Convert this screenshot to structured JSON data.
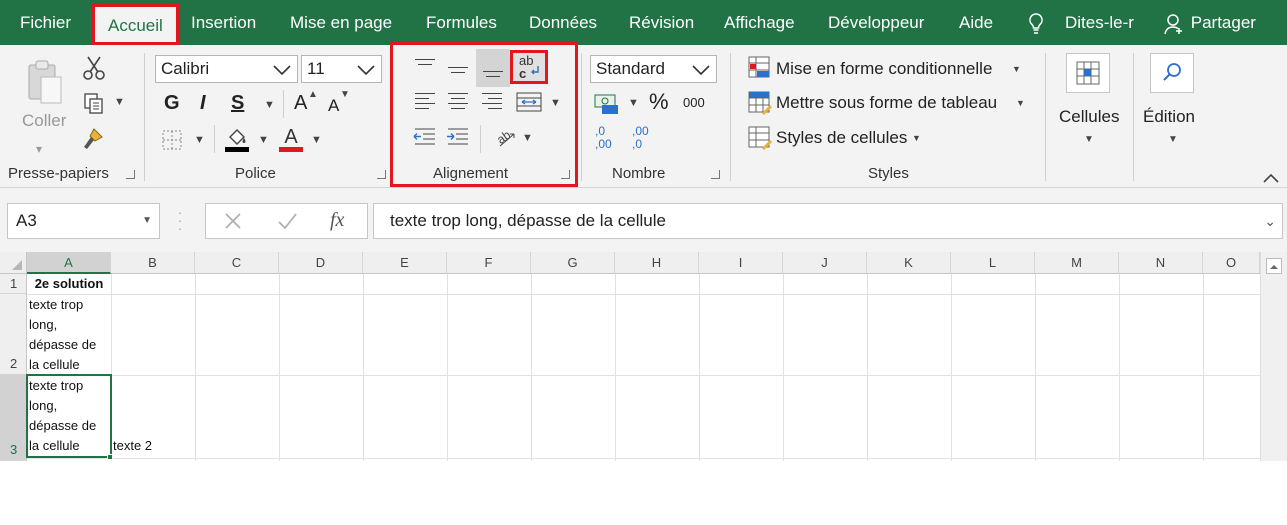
{
  "menu": {
    "tabs": [
      {
        "label": "Fichier"
      },
      {
        "label": "Accueil"
      },
      {
        "label": "Insertion"
      },
      {
        "label": "Mise en page"
      },
      {
        "label": "Formules"
      },
      {
        "label": "Données"
      },
      {
        "label": "Révision"
      },
      {
        "label": "Affichage"
      },
      {
        "label": "Développeur"
      },
      {
        "label": "Aide"
      }
    ],
    "active_tab": "Accueil",
    "tell_me": "Dites-le-r",
    "share": "Partager"
  },
  "ribbon": {
    "clipboard": {
      "paste": "Coller",
      "group": "Presse-papiers"
    },
    "font": {
      "name": "Calibri",
      "size": "11",
      "bold": "G",
      "italic": "I",
      "underline": "S",
      "grow": "A",
      "shrink": "A",
      "group": "Police",
      "fill_color": "#000000",
      "font_color": "#e2161e"
    },
    "alignment": {
      "group": "Alignement",
      "wrap_icon": "ab c"
    },
    "number": {
      "format": "Standard",
      "percent": "%",
      "thousands": "000",
      "inc_decimal": ",0 ,00",
      "dec_decimal": ",00 ,0",
      "group": "Nombre"
    },
    "styles": {
      "conditional": "Mise en forme conditionnelle",
      "table": "Mettre sous forme de tableau",
      "cell_styles": "Styles de cellules",
      "group": "Styles"
    },
    "cells": {
      "label": "Cellules"
    },
    "editing": {
      "label": "Édition"
    }
  },
  "formula_bar": {
    "name_box": "A3",
    "fx": "fx",
    "content": "texte trop long, dépasse de la cellule"
  },
  "sheet": {
    "columns": [
      "A",
      "B",
      "C",
      "D",
      "E",
      "F",
      "G",
      "H",
      "I",
      "J",
      "K",
      "L",
      "M",
      "N",
      "O"
    ],
    "rows": [
      "1",
      "2",
      "3"
    ],
    "selected_cell": "A3",
    "cells": {
      "A1": "2e solution",
      "A2": "texte trop long, dépasse de la cellule",
      "A3": "texte trop long, dépasse de la cellule",
      "B3": "texte 2"
    }
  },
  "colors": {
    "excel_green": "#217346",
    "highlight_red": "#e2161e"
  }
}
